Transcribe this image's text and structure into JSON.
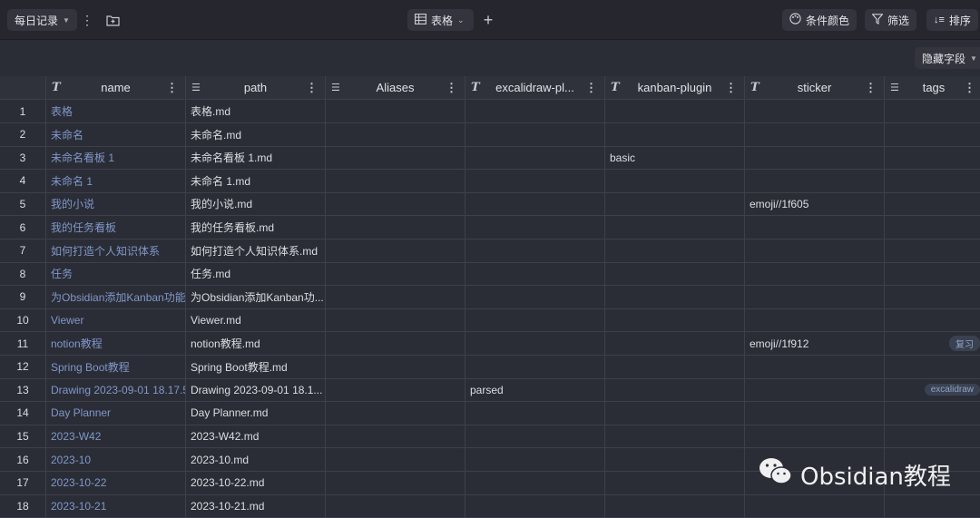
{
  "toolbar": {
    "view_name": "每日记录",
    "view_type": "表格",
    "add_label": "+",
    "cond_color": "条件颜色",
    "filter": "筛选",
    "sort": "排序",
    "hide_fields": "隐藏字段"
  },
  "columns": [
    {
      "type": "T",
      "title": "name"
    },
    {
      "type": "list",
      "title": "path"
    },
    {
      "type": "list",
      "title": "Aliases"
    },
    {
      "type": "T",
      "title": "excalidraw-pl..."
    },
    {
      "type": "T",
      "title": "kanban-plugin"
    },
    {
      "type": "T",
      "title": "sticker"
    },
    {
      "type": "list",
      "title": "tags"
    }
  ],
  "rows": [
    {
      "idx": "1",
      "name": "表格",
      "path": "表格.md",
      "aliases": "",
      "excalidraw": "",
      "kanban": "",
      "sticker": "",
      "tags": ""
    },
    {
      "idx": "2",
      "name": "未命名",
      "path": "未命名.md",
      "aliases": "",
      "excalidraw": "",
      "kanban": "",
      "sticker": "",
      "tags": ""
    },
    {
      "idx": "3",
      "name": "未命名看板 1",
      "path": "未命名看板 1.md",
      "aliases": "",
      "excalidraw": "",
      "kanban": "basic",
      "sticker": "",
      "tags": ""
    },
    {
      "idx": "4",
      "name": "未命名 1",
      "path": "未命名 1.md",
      "aliases": "",
      "excalidraw": "",
      "kanban": "",
      "sticker": "",
      "tags": ""
    },
    {
      "idx": "5",
      "name": "我的小说",
      "path": "我的小说.md",
      "aliases": "",
      "excalidraw": "",
      "kanban": "",
      "sticker": "emoji//1f605",
      "tags": ""
    },
    {
      "idx": "6",
      "name": "我的任务看板",
      "path": "我的任务看板.md",
      "aliases": "",
      "excalidraw": "",
      "kanban": "",
      "sticker": "",
      "tags": ""
    },
    {
      "idx": "7",
      "name": "如何打造个人知识体系",
      "path": "如何打造个人知识体系.md",
      "aliases": "",
      "excalidraw": "",
      "kanban": "",
      "sticker": "",
      "tags": ""
    },
    {
      "idx": "8",
      "name": "任务",
      "path": "任务.md",
      "aliases": "",
      "excalidraw": "",
      "kanban": "",
      "sticker": "",
      "tags": ""
    },
    {
      "idx": "9",
      "name": "为Obsidian添加Kanban功能:",
      "path": "为Obsidian添加Kanban功...",
      "aliases": "",
      "excalidraw": "",
      "kanban": "",
      "sticker": "",
      "tags": ""
    },
    {
      "idx": "10",
      "name": "Viewer",
      "path": "Viewer.md",
      "aliases": "",
      "excalidraw": "",
      "kanban": "",
      "sticker": "",
      "tags": ""
    },
    {
      "idx": "11",
      "name": "notion教程",
      "path": "notion教程.md",
      "aliases": "",
      "excalidraw": "",
      "kanban": "",
      "sticker": "emoji//1f912",
      "tags": "复习"
    },
    {
      "idx": "12",
      "name": "Spring Boot教程",
      "path": "Spring Boot教程.md",
      "aliases": "",
      "excalidraw": "",
      "kanban": "",
      "sticker": "",
      "tags": ""
    },
    {
      "idx": "13",
      "name": "Drawing 2023-09-01 18.17.5",
      "path": "Drawing 2023-09-01 18.1...",
      "aliases": "",
      "excalidraw": "parsed",
      "kanban": "",
      "sticker": "",
      "tags": "excalidraw"
    },
    {
      "idx": "14",
      "name": "Day Planner",
      "path": "Day Planner.md",
      "aliases": "",
      "excalidraw": "",
      "kanban": "",
      "sticker": "",
      "tags": ""
    },
    {
      "idx": "15",
      "name": "2023-W42",
      "path": "2023-W42.md",
      "aliases": "",
      "excalidraw": "",
      "kanban": "",
      "sticker": "",
      "tags": ""
    },
    {
      "idx": "16",
      "name": "2023-10",
      "path": "2023-10.md",
      "aliases": "",
      "excalidraw": "",
      "kanban": "",
      "sticker": "",
      "tags": ""
    },
    {
      "idx": "17",
      "name": "2023-10-22",
      "path": "2023-10-22.md",
      "aliases": "",
      "excalidraw": "",
      "kanban": "",
      "sticker": "",
      "tags": ""
    },
    {
      "idx": "18",
      "name": "2023-10-21",
      "path": "2023-10-21.md",
      "aliases": "",
      "excalidraw": "",
      "kanban": "",
      "sticker": "",
      "tags": ""
    }
  ],
  "watermark": "Obsidian教程"
}
